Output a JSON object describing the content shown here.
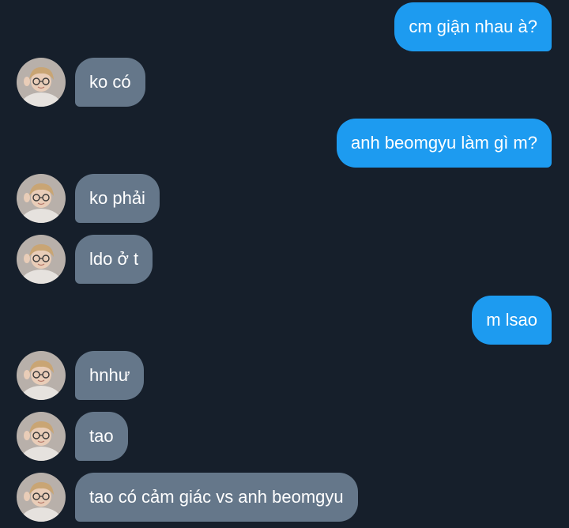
{
  "accent_outgoing": "#1d9bf0",
  "accent_incoming": "#65778a",
  "background": "#161f2b",
  "messages": [
    {
      "from": "me",
      "text": "cm giận nhau à?"
    },
    {
      "from": "them",
      "text": "ko có"
    },
    {
      "from": "me",
      "text": "anh beomgyu làm gì m?"
    },
    {
      "from": "them",
      "text": "ko phải"
    },
    {
      "from": "them",
      "text": "ldo ở t"
    },
    {
      "from": "me",
      "text": "m lsao"
    },
    {
      "from": "them",
      "text": "hnhư"
    },
    {
      "from": "them",
      "text": "tao"
    },
    {
      "from": "them",
      "text": "tao có cảm giác vs anh beomgyu"
    }
  ]
}
